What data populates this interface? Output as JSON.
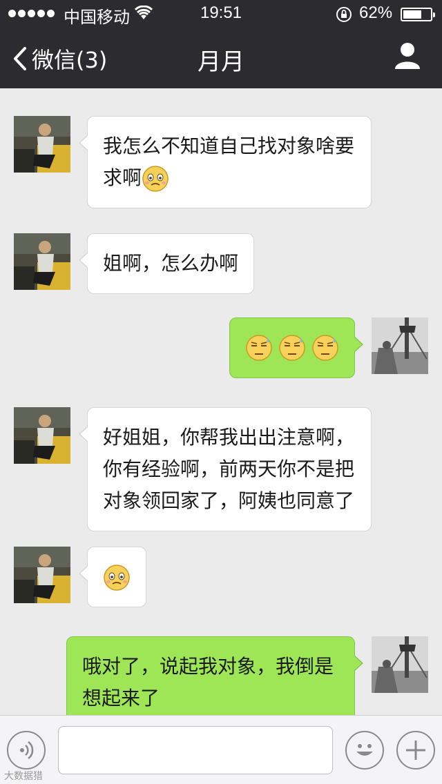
{
  "status_bar": {
    "carrier": "中国移动",
    "time": "19:51",
    "battery": "62%",
    "battery_level": 0.62
  },
  "nav": {
    "back_label": "微信(3)",
    "title": "月月"
  },
  "messages": [
    {
      "side": "left",
      "text": "我怎么不知道自己找对象啥要求啊",
      "emoji": [
        "worried-face"
      ]
    },
    {
      "side": "left",
      "text": "姐啊，怎么办啊"
    },
    {
      "side": "right",
      "text": "",
      "emoji": [
        "sweat-face",
        "sweat-face",
        "sweat-face"
      ]
    },
    {
      "side": "left",
      "text": "好姐姐，你帮我出出注意啊，你有经验啊，前两天你不是把对象领回家了，阿姨也同意了"
    },
    {
      "side": "left",
      "text": "",
      "emoji": [
        "worried-face"
      ]
    },
    {
      "side": "right",
      "text": "哦对了，说起我对象，我倒是想起来了"
    }
  ],
  "input_bar": {
    "placeholder": "",
    "voice_icon": "voice-icon",
    "emoji_icon": "smiley-icon",
    "plus_icon": "plus-icon"
  },
  "watermark": "大数据猎"
}
